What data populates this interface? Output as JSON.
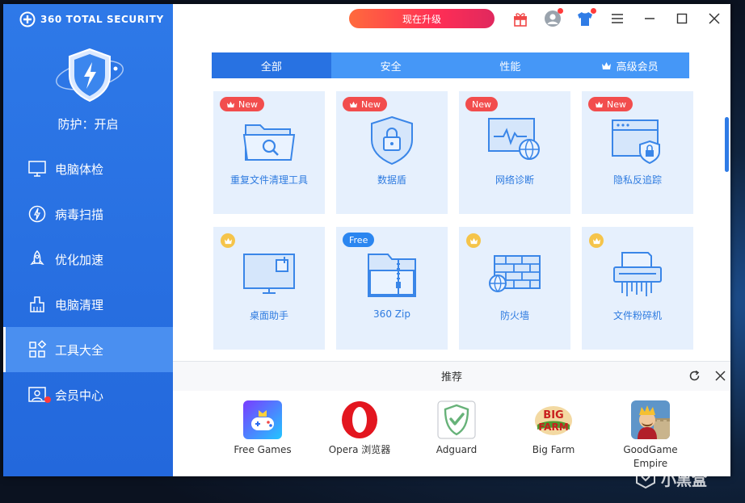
{
  "app": {
    "brand": "360 TOTAL SECURITY",
    "protection_status": "防护：开启"
  },
  "titlebar": {
    "upgrade_label": "现在升级"
  },
  "sidebar": {
    "items": [
      {
        "label": "电脑体检",
        "icon": "monitor-icon"
      },
      {
        "label": "病毒扫描",
        "icon": "virus-scan-icon"
      },
      {
        "label": "优化加速",
        "icon": "rocket-icon"
      },
      {
        "label": "电脑清理",
        "icon": "broom-icon"
      },
      {
        "label": "工具大全",
        "icon": "toolbox-icon",
        "active": true
      },
      {
        "label": "会员中心",
        "icon": "member-icon",
        "notification": true
      }
    ]
  },
  "tabs": [
    {
      "label": "全部",
      "active": true
    },
    {
      "label": "安全"
    },
    {
      "label": "性能"
    },
    {
      "label": "高级会员",
      "icon": "crown-icon"
    }
  ],
  "tools": [
    {
      "label": "重复文件清理工具",
      "tag": "New",
      "tag_icon": "crown-icon",
      "icon": "folder-search-icon"
    },
    {
      "label": "数据盾",
      "tag": "New",
      "tag_icon": "crown-icon",
      "icon": "data-shield-icon"
    },
    {
      "label": "网络诊断",
      "tag": "New",
      "icon": "network-diagnosis-icon"
    },
    {
      "label": "隐私反追踪",
      "tag": "New",
      "tag_icon": "crown-icon",
      "icon": "privacy-icon"
    },
    {
      "label": "桌面助手",
      "badge": "crown-icon",
      "icon": "desktop-helper-icon"
    },
    {
      "label": "360 Zip",
      "tag": "Free",
      "icon": "zip-icon"
    },
    {
      "label": "防火墙",
      "badge": "crown-icon",
      "icon": "firewall-icon"
    },
    {
      "label": "文件粉碎机",
      "badge": "crown-icon",
      "icon": "shredder-icon"
    }
  ],
  "recommend": {
    "title": "推荐",
    "apps": [
      {
        "name": "Free Games",
        "icon": "free-games-icon"
      },
      {
        "name": "Opera 浏览器",
        "icon": "opera-icon"
      },
      {
        "name": "Adguard",
        "icon": "adguard-icon"
      },
      {
        "name": "Big Farm",
        "icon": "big-farm-icon",
        "logo_text": "BIG FARM"
      },
      {
        "name": "GoodGame Empire",
        "icon": "goodgame-empire-icon"
      }
    ]
  },
  "watermark": {
    "text": "小黑盒"
  },
  "colors": {
    "sidebar": "#2e79e8",
    "accent": "#2f7ce6",
    "card_bg": "#e6f0fd",
    "new_tag": "#f24d4d",
    "upgrade": "#ff2e55"
  }
}
